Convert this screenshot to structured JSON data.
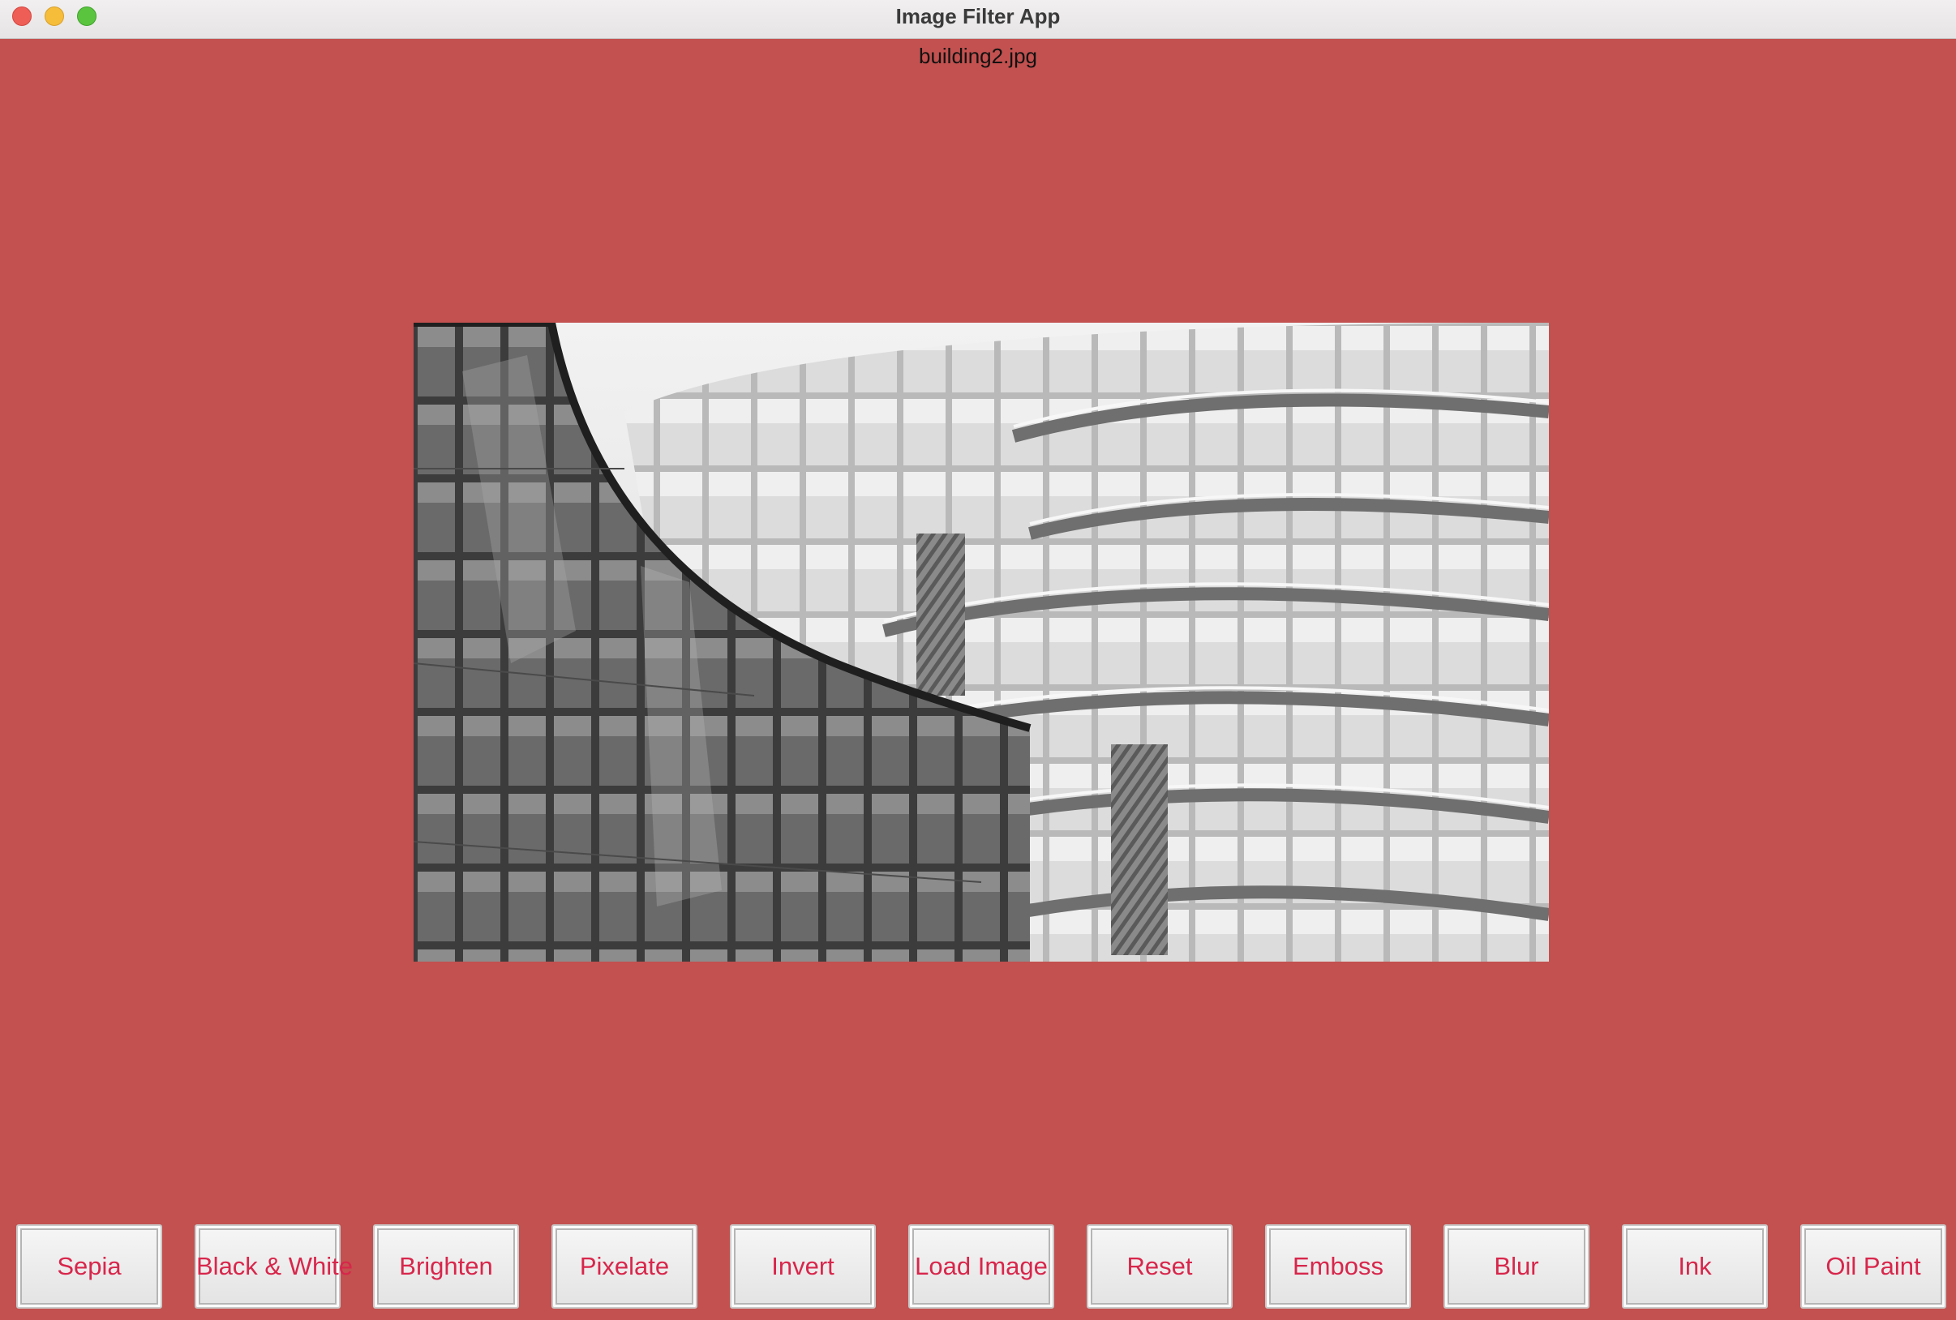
{
  "window": {
    "title": "Image Filter App"
  },
  "image": {
    "filename": "building2.jpg",
    "filter_applied": "grayscale"
  },
  "toolbar": {
    "buttons": [
      {
        "label": "Sepia"
      },
      {
        "label": "Black & White"
      },
      {
        "label": "Brighten"
      },
      {
        "label": "Pixelate"
      },
      {
        "label": "Invert"
      },
      {
        "label": "Load Image"
      },
      {
        "label": "Reset"
      },
      {
        "label": "Emboss"
      },
      {
        "label": "Blur"
      },
      {
        "label": "Ink"
      },
      {
        "label": "Oil Paint"
      }
    ]
  },
  "colors": {
    "background": "#c2514f",
    "button_text": "#d8264b"
  }
}
